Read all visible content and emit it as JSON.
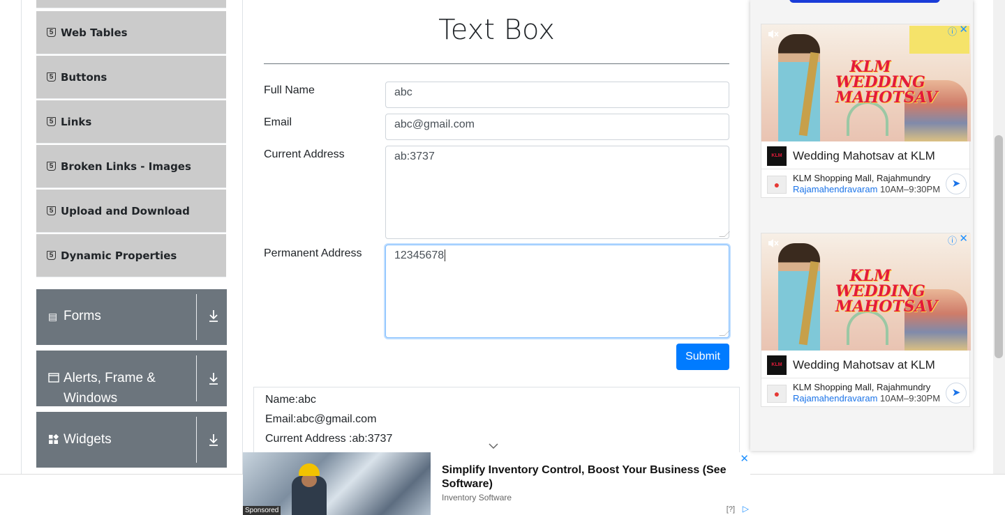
{
  "sidebar": {
    "items": [
      {
        "label": "Web Tables",
        "icon": "html5-icon"
      },
      {
        "label": "Buttons",
        "icon": "html5-icon"
      },
      {
        "label": "Links",
        "icon": "html5-icon"
      },
      {
        "label": "Broken Links - Images",
        "icon": "html5-icon"
      },
      {
        "label": "Upload and Download",
        "icon": "html5-icon"
      },
      {
        "label": "Dynamic Properties",
        "icon": "html5-icon"
      }
    ],
    "groups": [
      {
        "label": "Forms",
        "icon": "document-icon"
      },
      {
        "label": "Alerts, Frame & Windows",
        "icon": "window-icon"
      },
      {
        "label": "Widgets",
        "icon": "widgets-icon"
      }
    ]
  },
  "main": {
    "title": "Text Box",
    "form": {
      "full_name_label": "Full Name",
      "full_name_value": "abc",
      "email_label": "Email",
      "email_value": "abc@gmail.com",
      "current_address_label": "Current Address",
      "current_address_value": "ab:3737",
      "permanent_address_label": "Permanent Address",
      "permanent_address_value": "12345678",
      "submit_label": "Submit"
    },
    "output": {
      "name": "Name:abc",
      "email": "Email:abc@gmail.com",
      "current_address": "Current Address :ab:3737"
    }
  },
  "side_ads": [
    {
      "headline": "Wedding Mahotsav at KLM",
      "address": "KLM Shopping Mall, Rajahmundry",
      "city": "Rajamahendravaram",
      "hours": "10AM–9:30PM",
      "banner_title": "KLM WEDDING MAHOTSAV"
    },
    {
      "headline": "Wedding Mahotsav at KLM",
      "address": "KLM Shopping Mall, Rajahmundry",
      "city": "Rajamahendravaram",
      "hours": "10AM–9:30PM",
      "banner_title": "KLM WEDDING MAHOTSAV"
    }
  ],
  "bottom_ad": {
    "headline": "Simplify Inventory Control, Boost Your Business (See Software)",
    "source": "Inventory Software",
    "sponsored": "Sponsored",
    "info": "[?]"
  },
  "colors": {
    "menu_item_bg": "#cbcbcb",
    "group_bg": "#6c757d",
    "primary": "#007bff",
    "focus_border": "#80bdff"
  }
}
